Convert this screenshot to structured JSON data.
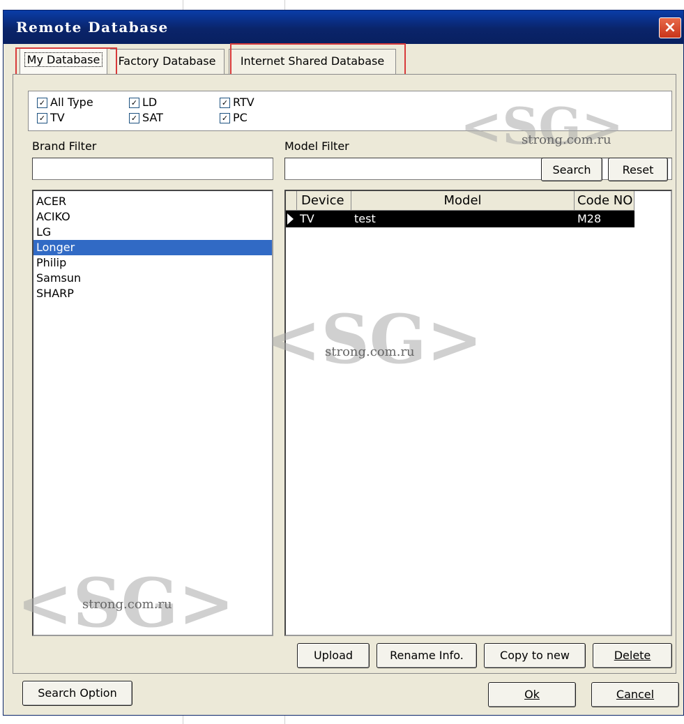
{
  "window": {
    "title": "Remote Database",
    "close_icon": "close-icon"
  },
  "tabs": [
    {
      "label": "My Database",
      "active": true
    },
    {
      "label": "Factory Database",
      "active": false
    },
    {
      "label": "Internet Shared Database",
      "active": false
    }
  ],
  "device_types": [
    {
      "label": "All Type",
      "checked": true
    },
    {
      "label": "LD",
      "checked": true
    },
    {
      "label": "RTV",
      "checked": true
    },
    {
      "label": "TV",
      "checked": true
    },
    {
      "label": "SAT",
      "checked": true
    },
    {
      "label": "PC",
      "checked": true
    }
  ],
  "brand_filter": {
    "label": "Brand Filter",
    "value": "",
    "brands": [
      "ACER",
      "ACIKO",
      "LG",
      "Longer",
      "Philip",
      "Samsun",
      "SHARP"
    ],
    "selected": "Longer"
  },
  "model_filter": {
    "label": "Model Filter",
    "value": "",
    "search_label": "Search",
    "reset_label": "Reset"
  },
  "grid": {
    "columns": [
      "Device",
      "Model",
      "Code NO"
    ],
    "rows": [
      {
        "device": "TV",
        "model": "test",
        "code": "M28"
      }
    ]
  },
  "actions": {
    "upload": "Upload",
    "rename": "Rename Info.",
    "copy": "Copy to new",
    "delete": "Delete"
  },
  "footer": {
    "search_option": "Search Option",
    "ok": "Ok",
    "cancel": "Cancel"
  },
  "watermark": {
    "logo": "<SG>",
    "url": "strong.com.ru"
  },
  "colors": {
    "title_bar": "#0a246a",
    "selection": "#316ac5",
    "highlight_box": "#d83a3a"
  }
}
